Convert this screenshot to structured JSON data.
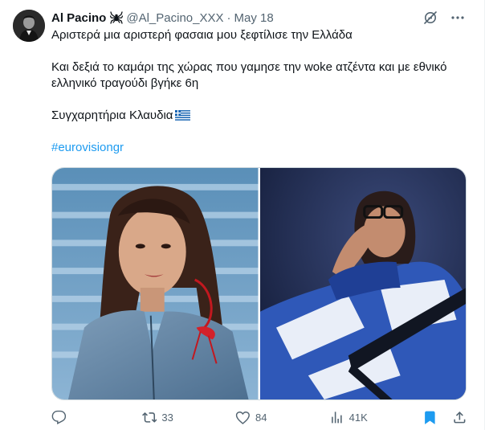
{
  "tweet": {
    "author_name": "Al Pacino",
    "author_icon": "spider-icon",
    "handle": "@Al_Pacino_XXX",
    "separator": "·",
    "date": "May 18",
    "lines": [
      "Αριστερά μια αριστερή φασαια μου ξεφτίλισε την Ελλάδα",
      "Και δεξιά το καμάρι της χώρας που γαμησε την woke ατζέντα και με εθνικό ελληνικό τραγούδι βγήκε 6η",
      "Συγχαρητήρια Κλαυδια"
    ],
    "hashtag": "#eurovisiongr"
  },
  "actions": {
    "replies": "",
    "retweets": "33",
    "likes": "84",
    "views": "41K"
  },
  "colors": {
    "accent": "#1d9bf0",
    "muted": "#536471",
    "text": "#0f1419"
  }
}
